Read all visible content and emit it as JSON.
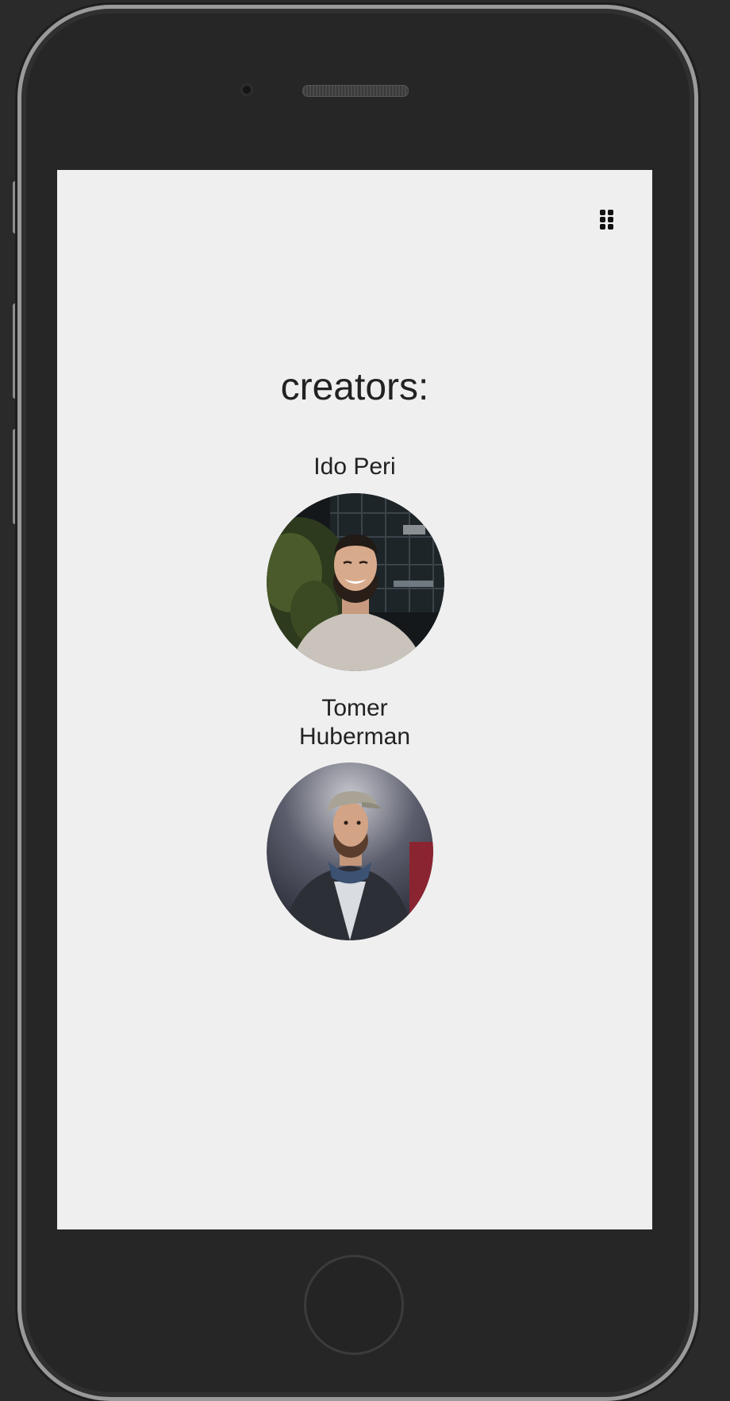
{
  "page": {
    "title": "creators:"
  },
  "menu": {
    "icon": "grid-menu-icon"
  },
  "creators": [
    {
      "name": "Ido Peri",
      "avatar_icon": "creator-photo-icon"
    },
    {
      "name_line1": "Tomer",
      "name_line2": "Huberman",
      "avatar_icon": "creator-photo-icon"
    }
  ],
  "colors": {
    "screen_background": "#efefef",
    "text": "#222222",
    "device_frame": "#262626"
  }
}
